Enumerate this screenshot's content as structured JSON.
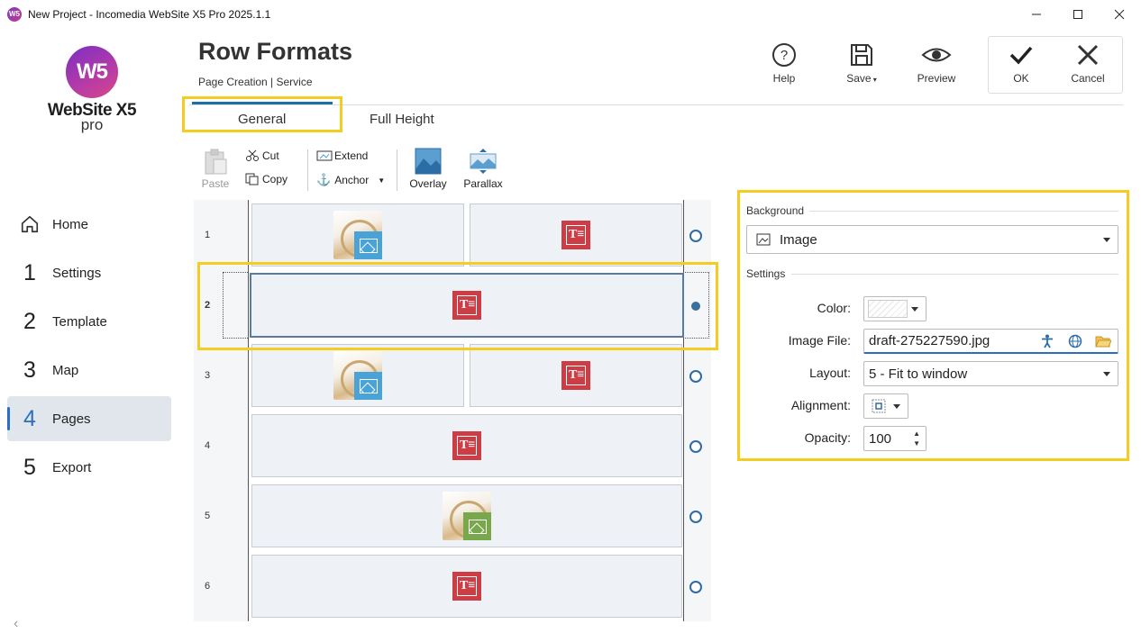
{
  "window": {
    "title": "New Project - Incomedia WebSite X5 Pro 2025.1.1"
  },
  "logo": {
    "mark": "W5",
    "name": "WebSite X5",
    "edition": "pro"
  },
  "nav": [
    {
      "num": "",
      "label": "Home"
    },
    {
      "num": "1",
      "label": "Settings"
    },
    {
      "num": "2",
      "label": "Template"
    },
    {
      "num": "3",
      "label": "Map"
    },
    {
      "num": "4",
      "label": "Pages",
      "active": true
    },
    {
      "num": "5",
      "label": "Export"
    }
  ],
  "header": {
    "title": "Row Formats",
    "breadcrumb": "Page Creation | Service",
    "help": "Help",
    "save": "Save",
    "preview": "Preview",
    "ok": "OK",
    "cancel": "Cancel"
  },
  "tabs": [
    {
      "label": "General",
      "active": true
    },
    {
      "label": "Full Height"
    }
  ],
  "toolbar": {
    "paste": "Paste",
    "cut": "Cut",
    "copy": "Copy",
    "extend": "Extend",
    "anchor": "Anchor",
    "overlay": "Overlay",
    "parallax": "Parallax"
  },
  "rows": [
    {
      "num": "1",
      "cells": [
        "image",
        "text"
      ],
      "selected": false
    },
    {
      "num": "2",
      "cells": [
        "text"
      ],
      "selected": true
    },
    {
      "num": "3",
      "cells": [
        "image",
        "text"
      ],
      "selected": false
    },
    {
      "num": "4",
      "cells": [
        "text"
      ],
      "selected": false
    },
    {
      "num": "5",
      "cells": [
        "image-green"
      ],
      "selected": false
    },
    {
      "num": "6",
      "cells": [
        "text"
      ],
      "selected": false
    }
  ],
  "background": {
    "section_label": "Background",
    "type": "Image",
    "settings_label": "Settings",
    "color_label": "Color:",
    "image_file_label": "Image File:",
    "image_file": "draft-275227590.jpg",
    "layout_label": "Layout:",
    "layout": "5 - Fit to window",
    "alignment_label": "Alignment:",
    "opacity_label": "Opacity:",
    "opacity": "100"
  },
  "colors": {
    "accent": "#1d6fa5",
    "highlight": "#f5cc22",
    "text_icon": "#cc3d45",
    "image_badge_blue": "#4aa3d6",
    "image_badge_green": "#79a74c"
  }
}
